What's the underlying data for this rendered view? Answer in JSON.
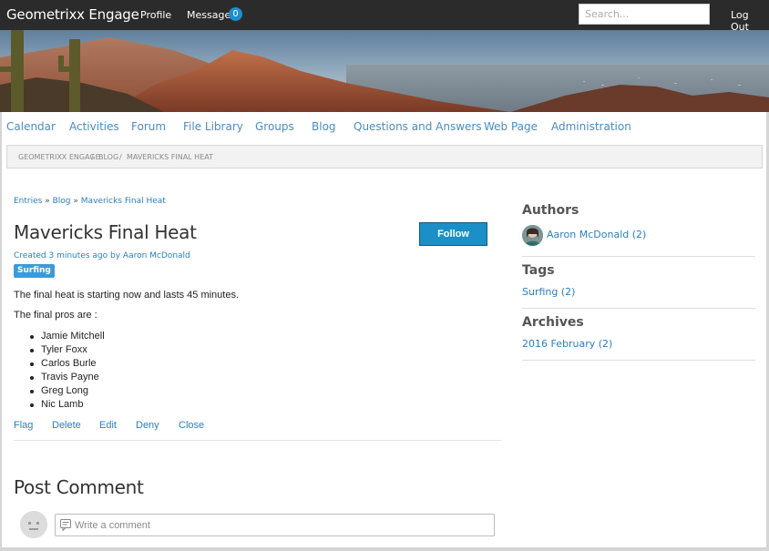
{
  "header": {
    "brand": "Geometrixx Engage",
    "profile_label": "Profile",
    "messages_label": "Messages",
    "messages_count": "0",
    "search_placeholder": "Search...",
    "logout_label": "Log Out"
  },
  "section_nav": [
    "Calendar",
    "Activities",
    "Forum",
    "File Library",
    "Groups",
    "Blog",
    "Questions and Answers",
    "Web Page",
    "Administration"
  ],
  "breadcrumb": [
    "GEOMETRIXX ENGAGE",
    "/",
    "BLOG",
    "/",
    "MAVERICKS FINAL HEAT"
  ],
  "entries_breadcrumb": [
    "Entries",
    "»",
    "Blog",
    "»",
    "Mavericks Final Heat"
  ],
  "post": {
    "title": "Mavericks Final Heat",
    "follow_label": "Follow",
    "meta_created": "Created",
    "meta_time": "3 minutes ago",
    "meta_by": "by",
    "meta_author": "Aaron McDonald",
    "tag": "Surfing",
    "paragraph1": "The final heat is starting now and lasts 45 minutes.",
    "paragraph2": "The final pros are :",
    "pros": [
      "Jamie Mitchell",
      "Tyler Foxx",
      "Carlos Burle",
      "Travis Payne",
      "Greg Long",
      "Nic Lamb"
    ],
    "actions": [
      "Flag",
      "Delete",
      "Edit",
      "Deny",
      "Close"
    ]
  },
  "comments": {
    "heading": "Post Comment",
    "placeholder": "Write a comment"
  },
  "sidebar": {
    "authors_heading": "Authors",
    "author_link": "Aaron McDonald (2)",
    "tags_heading": "Tags",
    "tag_link": "Surfing (2)",
    "archives_heading": "Archives",
    "archive_link": "2016 February (2)"
  },
  "colors": {
    "topbar": "#2b2b2b",
    "link": "#2a7fc0",
    "accent": "#1c8fc7",
    "tag": "#3b9bd8"
  }
}
